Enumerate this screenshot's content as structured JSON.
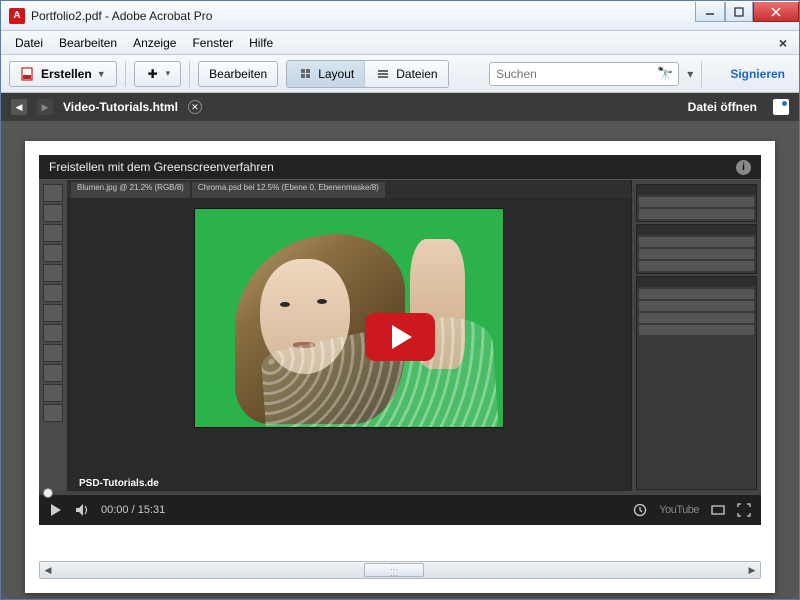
{
  "window": {
    "title": "Portfolio2.pdf - Adobe Acrobat Pro"
  },
  "menu": {
    "file": "Datei",
    "edit": "Bearbeiten",
    "view": "Anzeige",
    "window": "Fenster",
    "help": "Hilfe"
  },
  "toolbar": {
    "create": "Erstellen",
    "edit": "Bearbeiten",
    "layout": "Layout",
    "files": "Dateien",
    "search_placeholder": "Suchen",
    "sign": "Signieren"
  },
  "tabbar": {
    "current_tab": "Video-Tutorials.html",
    "open_file": "Datei öffnen"
  },
  "video": {
    "title": "Freistellen mit dem Greenscreenverfahren",
    "watermark": "PSD-Tutorials.de",
    "current_time": "00:00",
    "duration": "15:31",
    "provider": "YouTube",
    "ps_tabs": [
      "Blumen.jpg @ 21.2% (RGB/8)",
      "Chroma.psd bei 12.5% (Ebene 0, Ebenenmaske/8)"
    ]
  }
}
